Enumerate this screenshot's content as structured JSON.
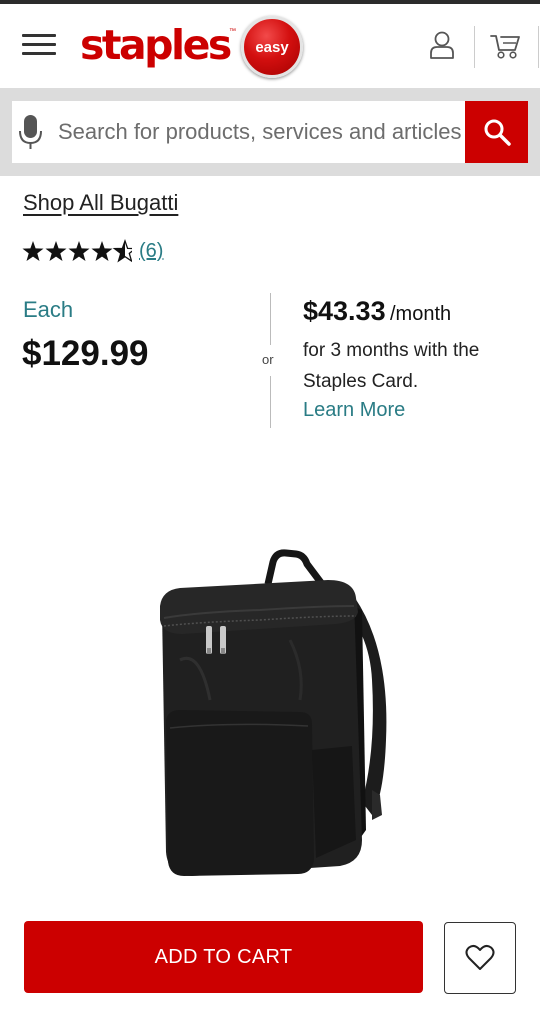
{
  "header": {
    "brand_name": "staples",
    "brand_tm": "™",
    "easy_button_label": "easy",
    "icons": [
      "menu-icon",
      "account-icon",
      "cart-icon"
    ]
  },
  "search": {
    "placeholder": "Search for products, services and articles",
    "icons": [
      "microphone-icon",
      "search-icon"
    ]
  },
  "product": {
    "brand_link": "Shop All Bugatti",
    "rating": 4.5,
    "rating_max": 5,
    "review_count": "(6)",
    "each_label": "Each",
    "price": "$129.99",
    "or_label": "or",
    "monthly_amount": "$43.33",
    "monthly_period": "/month",
    "monthly_description": "for 3 months with the Staples Card.",
    "learn_more": "Learn More"
  },
  "actions": {
    "add_to_cart": "ADD TO CART",
    "favorite_icon": "heart-icon"
  },
  "colors": {
    "brand_red": "#cc0000",
    "teal_link": "#2a7c85",
    "search_strip": "#dcdcdc"
  }
}
